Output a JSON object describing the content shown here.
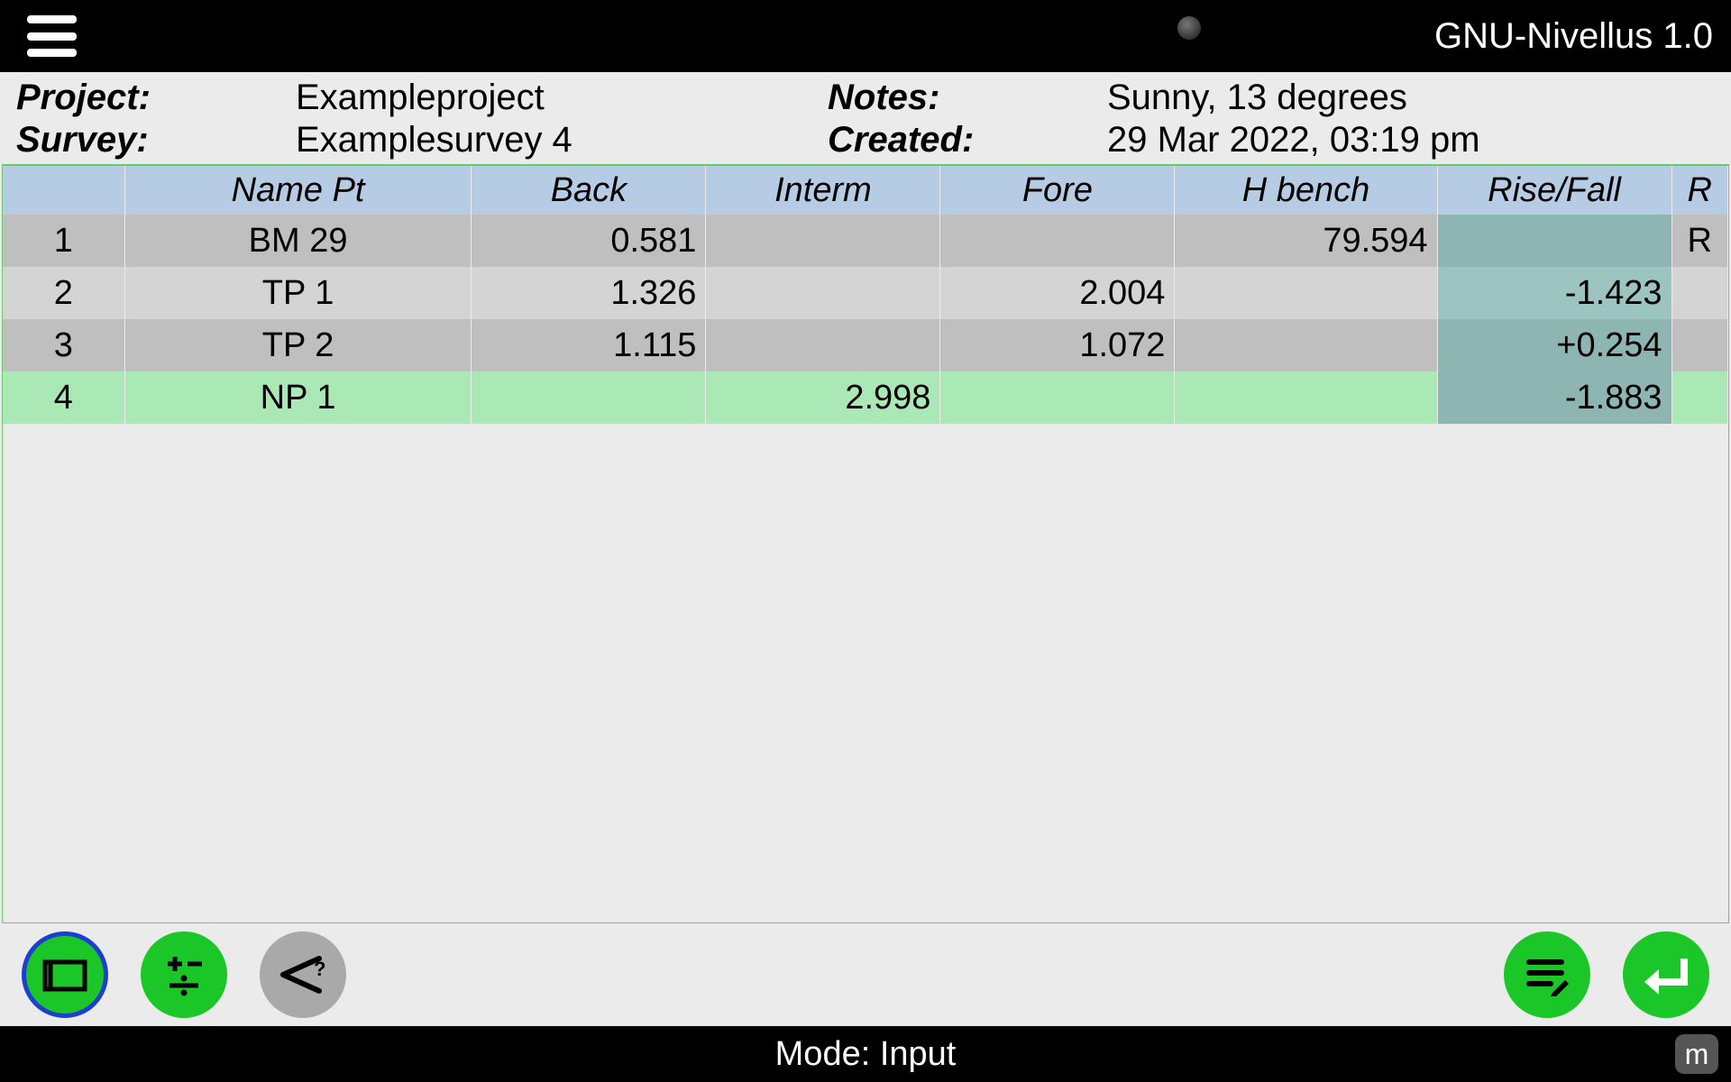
{
  "header": {
    "app_title": "GNU-Nivellus 1.0"
  },
  "info": {
    "project_label": "Project:",
    "project_value": "Exampleproject",
    "survey_label": "Survey:",
    "survey_value": "Examplesurvey 4",
    "notes_label": "Notes:",
    "notes_value": "Sunny, 13 degrees",
    "created_label": "Created:",
    "created_value": "29 Mar 2022, 03:19 pm"
  },
  "table": {
    "headers": {
      "idx": "",
      "name": "Name Pt",
      "back": "Back",
      "interm": "Interm",
      "fore": "Fore",
      "hbench": "H bench",
      "risefall": "Rise/Fall",
      "r": "R"
    },
    "rows": [
      {
        "idx": "1",
        "name": "BM 29",
        "back": "0.581",
        "interm": "",
        "fore": "",
        "hbench": "79.594",
        "risefall": "",
        "r": "R",
        "highlight": false,
        "zebra": "a"
      },
      {
        "idx": "2",
        "name": "TP 1",
        "back": "1.326",
        "interm": "",
        "fore": "2.004",
        "hbench": "",
        "risefall": "-1.423",
        "r": "",
        "highlight": false,
        "zebra": "b"
      },
      {
        "idx": "3",
        "name": "TP 2",
        "back": "1.115",
        "interm": "",
        "fore": "1.072",
        "hbench": "",
        "risefall": "+0.254",
        "r": "",
        "highlight": false,
        "zebra": "a"
      },
      {
        "idx": "4",
        "name": "NP 1",
        "back": "",
        "interm": "2.998",
        "fore": "",
        "hbench": "",
        "risefall": "-1.883",
        "r": "",
        "highlight": true,
        "zebra": "b"
      }
    ]
  },
  "status": {
    "mode_text": "Mode: Input",
    "unit": "m"
  }
}
